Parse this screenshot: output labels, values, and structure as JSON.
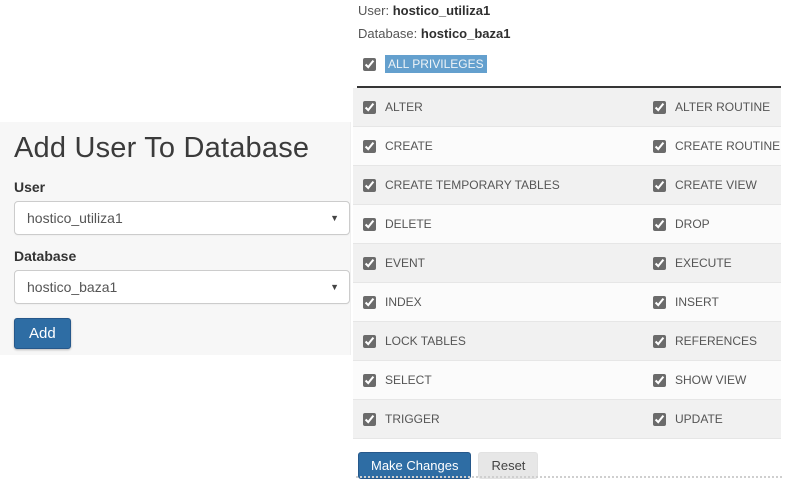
{
  "left_panel": {
    "title": "Add User To Database",
    "user_label": "User",
    "user_value": "hostico_utiliza1",
    "database_label": "Database",
    "database_value": "hostico_baza1",
    "add_button": "Add"
  },
  "right_panel": {
    "user_label": "User:",
    "user_value": "hostico_utiliza1",
    "database_label": "Database:",
    "database_value": "hostico_baza1",
    "all_privileges": {
      "label": "ALL PRIVILEGES",
      "checked": true,
      "highlighted": true
    },
    "privilege_rows": [
      {
        "left": {
          "label": "ALTER",
          "checked": true
        },
        "right": {
          "label": "ALTER ROUTINE",
          "checked": true
        }
      },
      {
        "left": {
          "label": "CREATE",
          "checked": true
        },
        "right": {
          "label": "CREATE ROUTINE",
          "checked": true
        }
      },
      {
        "left": {
          "label": "CREATE TEMPORARY TABLES",
          "checked": true
        },
        "right": {
          "label": "CREATE VIEW",
          "checked": true
        }
      },
      {
        "left": {
          "label": "DELETE",
          "checked": true
        },
        "right": {
          "label": "DROP",
          "checked": true
        }
      },
      {
        "left": {
          "label": "EVENT",
          "checked": true
        },
        "right": {
          "label": "EXECUTE",
          "checked": true
        }
      },
      {
        "left": {
          "label": "INDEX",
          "checked": true
        },
        "right": {
          "label": "INSERT",
          "checked": true
        }
      },
      {
        "left": {
          "label": "LOCK TABLES",
          "checked": true
        },
        "right": {
          "label": "REFERENCES",
          "checked": true
        }
      },
      {
        "left": {
          "label": "SELECT",
          "checked": true
        },
        "right": {
          "label": "SHOW VIEW",
          "checked": true
        }
      },
      {
        "left": {
          "label": "TRIGGER",
          "checked": true
        },
        "right": {
          "label": "UPDATE",
          "checked": true
        }
      }
    ],
    "make_changes_button": "Make Changes",
    "reset_button": "Reset"
  },
  "colors": {
    "primary_blue": "#2e6da4",
    "selection_blue": "#64a0ce",
    "panel_gray": "#f7f7f7",
    "stripe_gray": "#f1f1f1",
    "separator_dark": "#363636"
  }
}
